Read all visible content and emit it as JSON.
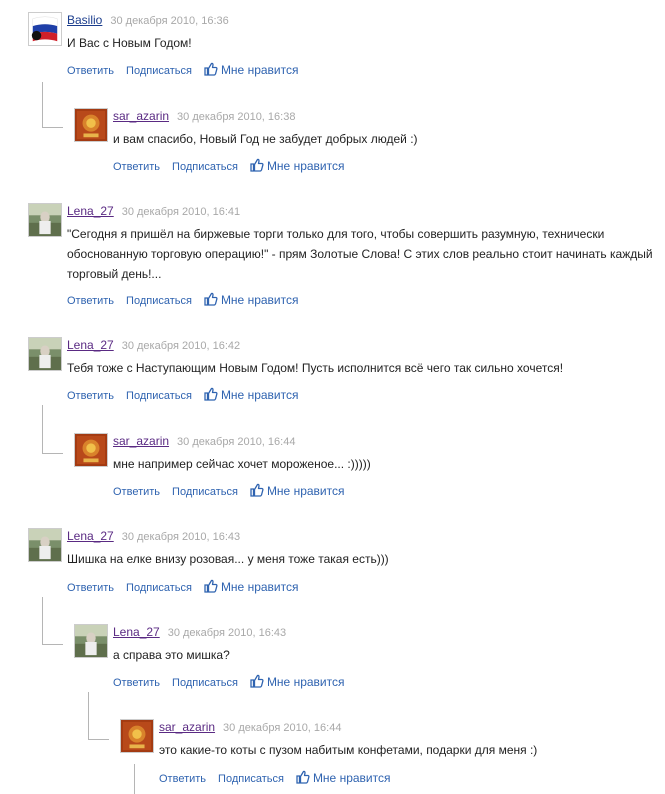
{
  "actions": {
    "reply": "Ответить",
    "subscribe": "Подписаться",
    "like": "Мне нравится"
  },
  "comments": [
    {
      "author": "Basilio",
      "date": "30 декабря 2010, 16:36",
      "text": "И Вас с Новым Годом!",
      "avatar": "flag-avatar"
    },
    {
      "author": "sar_azarin",
      "date": "30 декабря 2010, 16:38",
      "text": "и вам спасибо, Новый Год не забудет добрых людей :)",
      "avatar": "emblem-avatar"
    },
    {
      "author": "Lena_27",
      "date": "30 декабря 2010, 16:41",
      "text": "\"Сегодня я пришёл на биржевые торги только для того, чтобы совершить разумную, технически обоснованную торговую операцию!\" - прям Золотые Слова! С этих слов реально стоит начинать каждый торговый день!...",
      "avatar": "photo-avatar"
    },
    {
      "author": "Lena_27",
      "date": "30 декабря 2010, 16:42",
      "text": "Тебя тоже с Наступающим Новым Годом! Пусть исполнится всё чего так сильно хочется!",
      "avatar": "photo-avatar"
    },
    {
      "author": "sar_azarin",
      "date": "30 декабря 2010, 16:44",
      "text": "мне например сейчас хочет мороженое... :)))))",
      "avatar": "emblem-avatar"
    },
    {
      "author": "Lena_27",
      "date": "30 декабря 2010, 16:43",
      "text": "Шишка на елке внизу розовая... у меня тоже такая есть)))",
      "avatar": "photo-avatar"
    },
    {
      "author": "Lena_27",
      "date": "30 декабря 2010, 16:43",
      "text": "а справа это мишка?",
      "avatar": "photo-avatar"
    },
    {
      "author": "sar_azarin",
      "date": "30 декабря 2010, 16:44",
      "text": "это какие-то коты с пузом набитым конфетами, подарки для меня :)",
      "avatar": "emblem-avatar"
    }
  ]
}
